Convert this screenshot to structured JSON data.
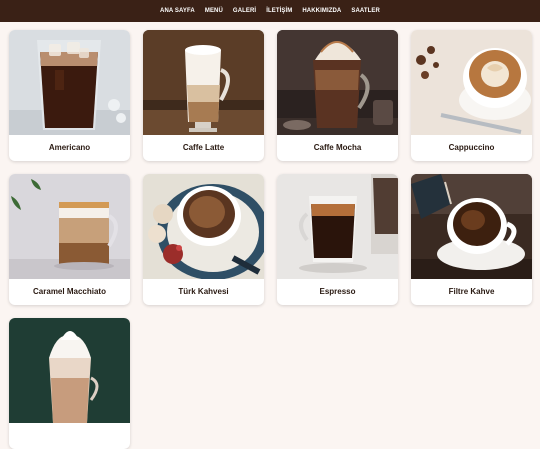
{
  "nav": {
    "items": [
      {
        "label": "ANA SAYFA"
      },
      {
        "label": "MENÜ"
      },
      {
        "label": "GALERİ"
      },
      {
        "label": "İLETİŞİM"
      },
      {
        "label": "HAKKIMIZDA"
      },
      {
        "label": "SAATLER"
      }
    ]
  },
  "menu": {
    "items": [
      {
        "name": "Americano"
      },
      {
        "name": "Caffe Latte"
      },
      {
        "name": "Caffe Mocha"
      },
      {
        "name": "Cappuccino"
      },
      {
        "name": "Caramel Macchiato"
      },
      {
        "name": "Türk Kahvesi"
      },
      {
        "name": "Espresso"
      },
      {
        "name": "Filtre Kahve"
      },
      {
        "name": ""
      }
    ]
  },
  "colors": {
    "nav_bg": "#3a2116",
    "page_bg": "#fbf5f2"
  }
}
